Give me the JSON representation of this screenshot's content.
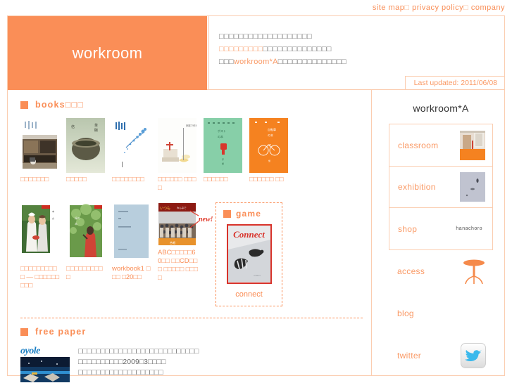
{
  "topnav": {
    "items": [
      {
        "label": "site map"
      },
      {
        "label": "privacy policy"
      },
      {
        "label": "company"
      }
    ],
    "separator": "□"
  },
  "header": {
    "logo": "workroom",
    "desc_line1": "□□□□□□□□□□□□□□□□□□□",
    "desc_line2_accent": "□□□□□□□□□",
    "desc_line2_rest": "□□□□□□□□□□□□□□",
    "desc_line3_pre": "□□□",
    "desc_line3_brand": "workroom*A",
    "desc_line3_post": "□□□□□□□□□□□□□□",
    "last_updated": "Last updated: 2011/06/08"
  },
  "books": {
    "heading": "books□□□",
    "bullet_icon": "orange-square-icon",
    "row1": [
      {
        "caption": "□□□□□□□",
        "cover": "book-cover-house"
      },
      {
        "caption": "□□□□□",
        "cover": "book-cover-bowl"
      },
      {
        "caption": "□□□□□□□□",
        "cover": "book-cover-blue-branch"
      },
      {
        "caption": "□□□□□□\n□□□□",
        "cover": "book-cover-cake"
      },
      {
        "caption": "□□□□□□",
        "cover": "book-cover-green-mailbox"
      },
      {
        "caption": "□□□□□□\n□□",
        "cover": "book-cover-orange-bicycle"
      }
    ],
    "row2": [
      {
        "caption": "□□□□□□□□□□ —\n□□□□□□□□□",
        "cover": "book-cover-chef-couple"
      },
      {
        "caption": "□□□□□□□□□□",
        "cover": "book-cover-green-leaves"
      },
      {
        "caption": "workbook1 □□□\n□20□□",
        "cover": "book-cover-workbook1"
      },
      {
        "caption": "ABC□□□□□60□□\n□□CD□□□ □□□□□\n□□□□",
        "cover": "book-cover-crowd",
        "badge": "new!"
      }
    ]
  },
  "game": {
    "heading": "game",
    "bullet_icon": "orange-square-icon",
    "card_title": "Connect",
    "label": "connect"
  },
  "free_paper": {
    "heading": "free paper",
    "bullet_icon": "orange-square-icon",
    "logo_text": "oyole",
    "line1": "□□□□□□□□□□□□□□□□□□□□□□□□□□□",
    "line2": "□□□□□□□□□□2009□3□□□□",
    "line3": "□□□□□□□□□□□□□□□□□□□"
  },
  "sidebar": {
    "title": "workroom*A",
    "items": [
      {
        "label": "classroom",
        "thumb": "classroom-photo"
      },
      {
        "label": "exhibition",
        "thumb": "exhibition-photo"
      },
      {
        "label": "shop",
        "thumb": "shop-logo-text",
        "shop_text": "hanachoro"
      },
      {
        "label": "access",
        "thumb": "table-stand-icon"
      },
      {
        "label": "blog",
        "thumb": ""
      },
      {
        "label": "twitter",
        "thumb": "twitter-bird-icon"
      }
    ]
  },
  "colors": {
    "brand_orange": "#FA8E57",
    "light_orange": "#FA9A66",
    "border_orange": "#FBCDB0",
    "red": "#D8322A",
    "twitter_blue": "#3BB9EC"
  }
}
